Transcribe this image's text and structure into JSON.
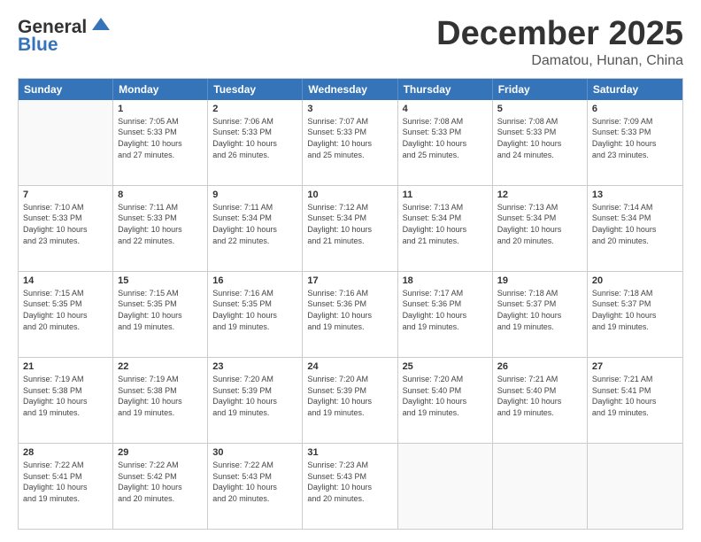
{
  "header": {
    "logo_line1": "General",
    "logo_line2": "Blue",
    "month": "December 2025",
    "location": "Damatou, Hunan, China"
  },
  "weekdays": [
    "Sunday",
    "Monday",
    "Tuesday",
    "Wednesday",
    "Thursday",
    "Friday",
    "Saturday"
  ],
  "rows": [
    [
      {
        "day": "",
        "info": ""
      },
      {
        "day": "1",
        "info": "Sunrise: 7:05 AM\nSunset: 5:33 PM\nDaylight: 10 hours\nand 27 minutes."
      },
      {
        "day": "2",
        "info": "Sunrise: 7:06 AM\nSunset: 5:33 PM\nDaylight: 10 hours\nand 26 minutes."
      },
      {
        "day": "3",
        "info": "Sunrise: 7:07 AM\nSunset: 5:33 PM\nDaylight: 10 hours\nand 25 minutes."
      },
      {
        "day": "4",
        "info": "Sunrise: 7:08 AM\nSunset: 5:33 PM\nDaylight: 10 hours\nand 25 minutes."
      },
      {
        "day": "5",
        "info": "Sunrise: 7:08 AM\nSunset: 5:33 PM\nDaylight: 10 hours\nand 24 minutes."
      },
      {
        "day": "6",
        "info": "Sunrise: 7:09 AM\nSunset: 5:33 PM\nDaylight: 10 hours\nand 23 minutes."
      }
    ],
    [
      {
        "day": "7",
        "info": "Sunrise: 7:10 AM\nSunset: 5:33 PM\nDaylight: 10 hours\nand 23 minutes."
      },
      {
        "day": "8",
        "info": "Sunrise: 7:11 AM\nSunset: 5:33 PM\nDaylight: 10 hours\nand 22 minutes."
      },
      {
        "day": "9",
        "info": "Sunrise: 7:11 AM\nSunset: 5:34 PM\nDaylight: 10 hours\nand 22 minutes."
      },
      {
        "day": "10",
        "info": "Sunrise: 7:12 AM\nSunset: 5:34 PM\nDaylight: 10 hours\nand 21 minutes."
      },
      {
        "day": "11",
        "info": "Sunrise: 7:13 AM\nSunset: 5:34 PM\nDaylight: 10 hours\nand 21 minutes."
      },
      {
        "day": "12",
        "info": "Sunrise: 7:13 AM\nSunset: 5:34 PM\nDaylight: 10 hours\nand 20 minutes."
      },
      {
        "day": "13",
        "info": "Sunrise: 7:14 AM\nSunset: 5:34 PM\nDaylight: 10 hours\nand 20 minutes."
      }
    ],
    [
      {
        "day": "14",
        "info": "Sunrise: 7:15 AM\nSunset: 5:35 PM\nDaylight: 10 hours\nand 20 minutes."
      },
      {
        "day": "15",
        "info": "Sunrise: 7:15 AM\nSunset: 5:35 PM\nDaylight: 10 hours\nand 19 minutes."
      },
      {
        "day": "16",
        "info": "Sunrise: 7:16 AM\nSunset: 5:35 PM\nDaylight: 10 hours\nand 19 minutes."
      },
      {
        "day": "17",
        "info": "Sunrise: 7:16 AM\nSunset: 5:36 PM\nDaylight: 10 hours\nand 19 minutes."
      },
      {
        "day": "18",
        "info": "Sunrise: 7:17 AM\nSunset: 5:36 PM\nDaylight: 10 hours\nand 19 minutes."
      },
      {
        "day": "19",
        "info": "Sunrise: 7:18 AM\nSunset: 5:37 PM\nDaylight: 10 hours\nand 19 minutes."
      },
      {
        "day": "20",
        "info": "Sunrise: 7:18 AM\nSunset: 5:37 PM\nDaylight: 10 hours\nand 19 minutes."
      }
    ],
    [
      {
        "day": "21",
        "info": "Sunrise: 7:19 AM\nSunset: 5:38 PM\nDaylight: 10 hours\nand 19 minutes."
      },
      {
        "day": "22",
        "info": "Sunrise: 7:19 AM\nSunset: 5:38 PM\nDaylight: 10 hours\nand 19 minutes."
      },
      {
        "day": "23",
        "info": "Sunrise: 7:20 AM\nSunset: 5:39 PM\nDaylight: 10 hours\nand 19 minutes."
      },
      {
        "day": "24",
        "info": "Sunrise: 7:20 AM\nSunset: 5:39 PM\nDaylight: 10 hours\nand 19 minutes."
      },
      {
        "day": "25",
        "info": "Sunrise: 7:20 AM\nSunset: 5:40 PM\nDaylight: 10 hours\nand 19 minutes."
      },
      {
        "day": "26",
        "info": "Sunrise: 7:21 AM\nSunset: 5:40 PM\nDaylight: 10 hours\nand 19 minutes."
      },
      {
        "day": "27",
        "info": "Sunrise: 7:21 AM\nSunset: 5:41 PM\nDaylight: 10 hours\nand 19 minutes."
      }
    ],
    [
      {
        "day": "28",
        "info": "Sunrise: 7:22 AM\nSunset: 5:41 PM\nDaylight: 10 hours\nand 19 minutes."
      },
      {
        "day": "29",
        "info": "Sunrise: 7:22 AM\nSunset: 5:42 PM\nDaylight: 10 hours\nand 20 minutes."
      },
      {
        "day": "30",
        "info": "Sunrise: 7:22 AM\nSunset: 5:43 PM\nDaylight: 10 hours\nand 20 minutes."
      },
      {
        "day": "31",
        "info": "Sunrise: 7:23 AM\nSunset: 5:43 PM\nDaylight: 10 hours\nand 20 minutes."
      },
      {
        "day": "",
        "info": ""
      },
      {
        "day": "",
        "info": ""
      },
      {
        "day": "",
        "info": ""
      }
    ]
  ]
}
